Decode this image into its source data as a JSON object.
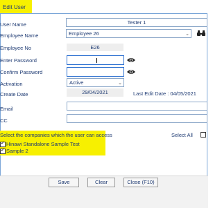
{
  "window": {
    "title": "Edit User"
  },
  "form": {
    "user_name": {
      "label": "User Name",
      "value": "Tester 1"
    },
    "employee_name": {
      "label": "Employee Name",
      "value": "Employee 26"
    },
    "employee_no": {
      "label": "Employee No",
      "value": "E26"
    },
    "enter_password": {
      "label": "Enter Password",
      "value": ""
    },
    "confirm_password": {
      "label": "Confirm Password",
      "value": ""
    },
    "activation": {
      "label": "Activation",
      "value": "Active"
    },
    "create_date": {
      "label": "Create Date",
      "value": "29/04/2021"
    },
    "last_edit_date": {
      "text": "Last Edit Date : 04/05/2021"
    },
    "email": {
      "label": "Email",
      "value": ""
    },
    "cc": {
      "label": "CC",
      "value": ""
    }
  },
  "companies": {
    "prompt": "Select the companies which the user can access",
    "select_all_label": "Select All",
    "select_all_checked": false,
    "items": [
      {
        "label": "Hinawi Standalone Sample Test",
        "checked": true
      },
      {
        "label": "Sample 2",
        "checked": true
      }
    ]
  },
  "icons": {
    "binoculars": "binoculars-icon",
    "eye": "eye-icon",
    "dropdown": "chevron-down-icon"
  },
  "footer": {
    "save_label": "Save",
    "clear_label": "Clear",
    "close_label": "Close (F10)"
  },
  "colors": {
    "highlight": "#f7f000",
    "text": "#1f3b73",
    "border": "#7aa6d8"
  }
}
